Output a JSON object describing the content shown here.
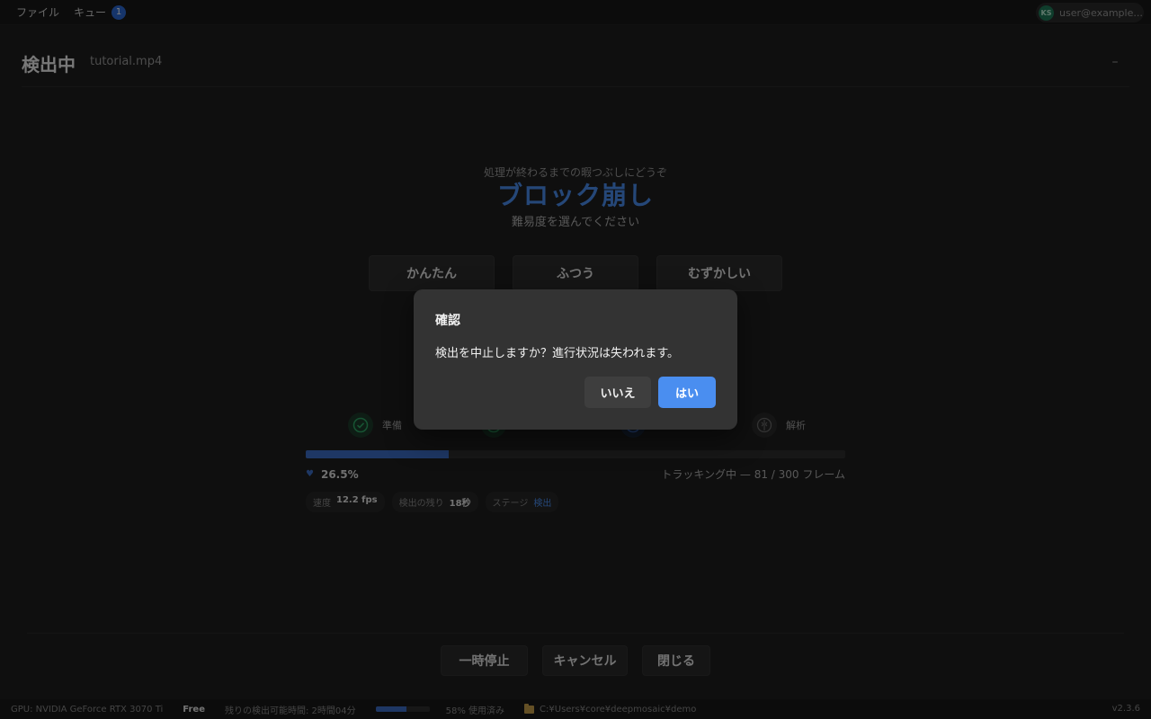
{
  "menubar": {
    "items": [
      {
        "label": "ファイル"
      },
      {
        "label": "キュー",
        "badge": "1"
      }
    ],
    "user": {
      "initials": "KS",
      "email": "user@example..."
    }
  },
  "header": {
    "title": "検出中",
    "file": "tutorial.mp4",
    "minimize_label": "–"
  },
  "game": {
    "subtitle": "処理が終わるまでの暇つぶしにどうぞ",
    "title": "ブロック崩し",
    "prompt": "難易度を選んでください",
    "difficulties": [
      "かんたん",
      "ふつう",
      "むずかしい"
    ]
  },
  "stages": [
    {
      "label": "準備",
      "status": "done"
    },
    {
      "label": "",
      "status": "done"
    },
    {
      "label": "",
      "status": "active"
    },
    {
      "label": "解析",
      "status": "pending"
    }
  ],
  "progress": {
    "percent_label": "26.5%",
    "fraction": 0.265,
    "status": "トラッキング中 — 81 / 300 フレーム"
  },
  "stats": [
    {
      "label": "速度",
      "value": "12.2 fps"
    },
    {
      "label": "検出の残り",
      "value": "18秒"
    },
    {
      "label": "ステージ",
      "value": "検出"
    }
  ],
  "controls": {
    "pause": "一時停止",
    "cancel": "キャンセル",
    "close": "閉じる"
  },
  "statusbar": {
    "gpu": "GPU: NVIDIA GeForce RTX 3070 Ti",
    "plan": "Free",
    "remaining": "残りの検出可能時間: 2時間04分",
    "usage_fraction": 0.58,
    "usage_label": "58% 使用済み",
    "path": "C:¥Users¥core¥deepmosaic¥demo",
    "version": "v2.3.6"
  },
  "dialog": {
    "title": "確認",
    "message": "検出を中止しますか？進行状況は失われます。",
    "no_label": "いいえ",
    "yes_label": "はい"
  },
  "colors": {
    "accent": "#4a8ef0",
    "progress": "#3d6fc9",
    "success": "#2fa866"
  }
}
